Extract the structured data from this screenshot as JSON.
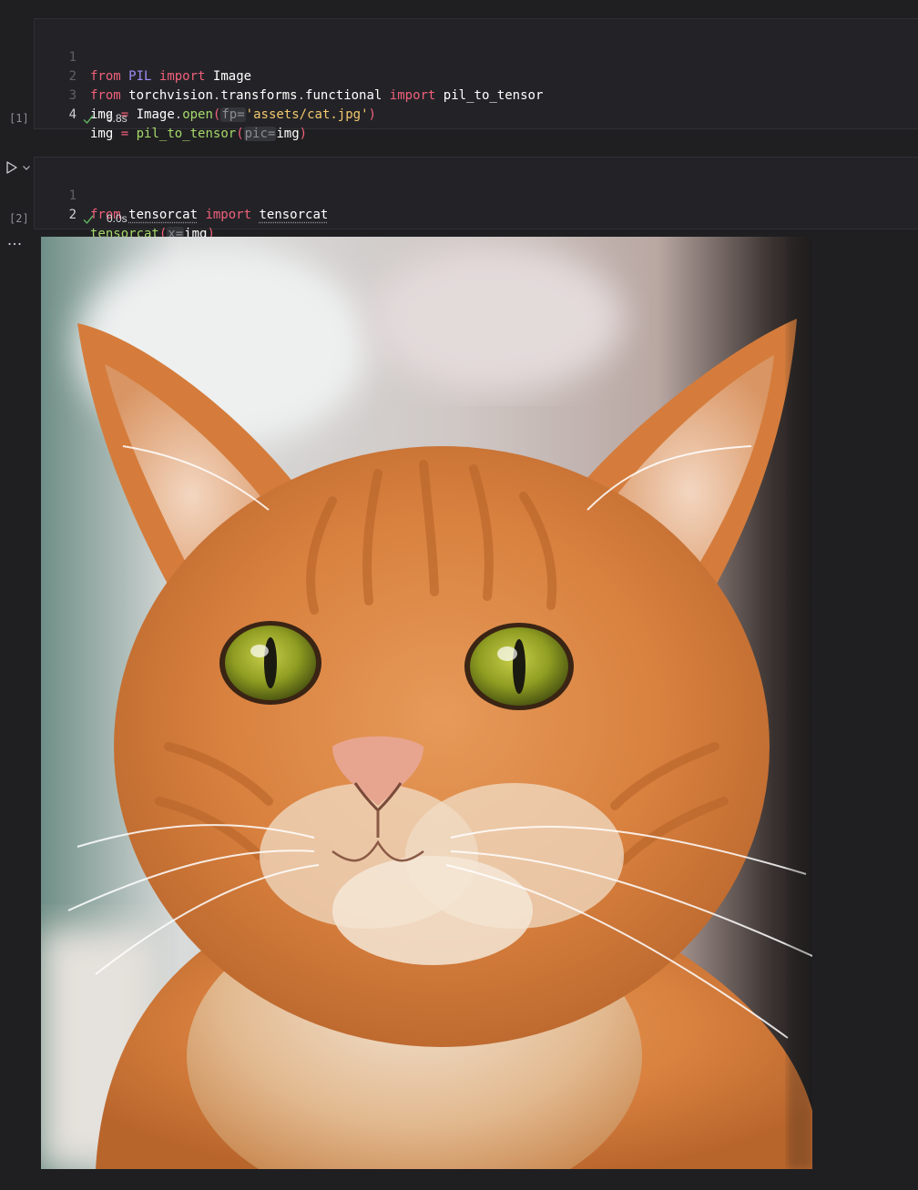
{
  "cells": [
    {
      "exec_count": "[1]",
      "duration": "0.8s",
      "line_numbers": [
        "1",
        "2",
        "3",
        "4"
      ],
      "code": {
        "l1": {
          "from": "from",
          "module": "PIL",
          "import": "import",
          "name": "Image"
        },
        "l2": {
          "from": "from",
          "mod1": "torchvision",
          "dot1": ".",
          "mod2": "transforms",
          "dot2": ".",
          "mod3": "functional",
          "import": "import",
          "name": "pil_to_tensor"
        },
        "l3": {
          "var": "img",
          "eq": "=",
          "obj": "Image",
          "dot": ".",
          "fn": "open",
          "lp": "(",
          "hint": "fp=",
          "str": "'assets/cat.jpg'",
          "rp": ")"
        },
        "l4": {
          "var": "img",
          "eq": "=",
          "fn": "pil_to_tensor",
          "lp": "(",
          "hint": "pic=",
          "arg": "img",
          "rp": ")"
        }
      }
    },
    {
      "exec_count": "[2]",
      "duration": "0.0s",
      "line_numbers": [
        "1",
        "2"
      ],
      "code": {
        "l1": {
          "from": "from",
          "module": "tensorcat",
          "import": "import",
          "name": "tensorcat"
        },
        "l2": {
          "fn": "tensorcat",
          "lp": "(",
          "hint": "x=",
          "arg": "img",
          "rp": ")"
        }
      }
    }
  ],
  "output": {
    "image_subject": "orange tabby cat"
  },
  "icons": {
    "run": "run-icon",
    "chevron": "chevron-down-icon",
    "more": "more-options-icon",
    "check": "check-icon"
  },
  "colors": {
    "background": "#1f1f22",
    "editor_bg": "#232327",
    "keyword": "#f0607a",
    "module": "#9d8cf6",
    "function": "#a6d96a",
    "string": "#f2c86d",
    "success": "#5fb35f"
  }
}
